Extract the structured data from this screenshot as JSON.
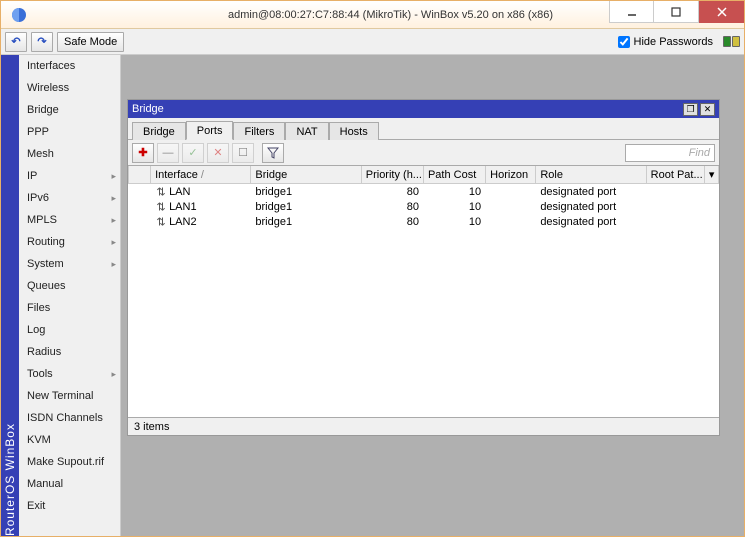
{
  "titlebar": {
    "title": "admin@08:00:27:C7:88:44 (MikroTik) - WinBox v5.20 on x86 (x86)"
  },
  "toolbar": {
    "undo": "↶",
    "redo": "↷",
    "safe_mode": "Safe Mode",
    "hide_passwords_label": "Hide Passwords",
    "hide_passwords_checked": true
  },
  "spine": {
    "label": "RouterOS WinBox"
  },
  "sidebar": {
    "items": [
      {
        "label": "Interfaces",
        "sub": false
      },
      {
        "label": "Wireless",
        "sub": false
      },
      {
        "label": "Bridge",
        "sub": false
      },
      {
        "label": "PPP",
        "sub": false
      },
      {
        "label": "Mesh",
        "sub": false
      },
      {
        "label": "IP",
        "sub": true
      },
      {
        "label": "IPv6",
        "sub": true
      },
      {
        "label": "MPLS",
        "sub": true
      },
      {
        "label": "Routing",
        "sub": true
      },
      {
        "label": "System",
        "sub": true
      },
      {
        "label": "Queues",
        "sub": false
      },
      {
        "label": "Files",
        "sub": false
      },
      {
        "label": "Log",
        "sub": false
      },
      {
        "label": "Radius",
        "sub": false
      },
      {
        "label": "Tools",
        "sub": true
      },
      {
        "label": "New Terminal",
        "sub": false
      },
      {
        "label": "ISDN Channels",
        "sub": false
      },
      {
        "label": "KVM",
        "sub": false
      },
      {
        "label": "Make Supout.rif",
        "sub": false
      },
      {
        "label": "Manual",
        "sub": false
      },
      {
        "label": "Exit",
        "sub": false
      }
    ]
  },
  "inner": {
    "title": "Bridge",
    "tabs": [
      "Bridge",
      "Ports",
      "Filters",
      "NAT",
      "Hosts"
    ],
    "active_tab": 1,
    "find_placeholder": "Find",
    "toolbar_icons": {
      "add": "✚",
      "remove": "—",
      "enable": "✓",
      "disable": "✕",
      "comment": "☐",
      "filter": "▼"
    },
    "columns": [
      "",
      "Interface",
      "Bridge",
      "Priority (h...",
      "Path Cost",
      "Horizon",
      "Role",
      "Root Pat..."
    ],
    "rows": [
      {
        "interface": "LAN",
        "bridge": "bridge1",
        "priority": "80",
        "pathcost": "10",
        "horizon": "",
        "role": "designated port",
        "rootpath": ""
      },
      {
        "interface": "LAN1",
        "bridge": "bridge1",
        "priority": "80",
        "pathcost": "10",
        "horizon": "",
        "role": "designated port",
        "rootpath": ""
      },
      {
        "interface": "LAN2",
        "bridge": "bridge1",
        "priority": "80",
        "pathcost": "10",
        "horizon": "",
        "role": "designated port",
        "rootpath": ""
      }
    ],
    "status": "3 items"
  }
}
